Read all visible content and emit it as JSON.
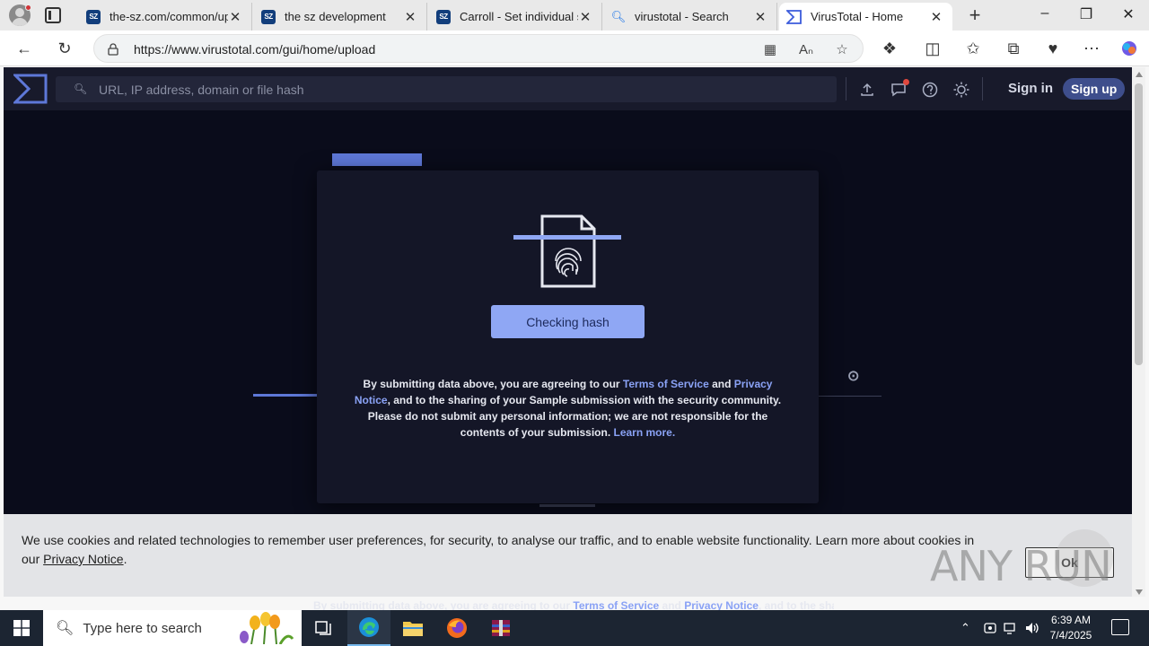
{
  "browser": {
    "tabs": [
      {
        "title": "the-sz.com/common/upl",
        "favicon": "sz-icon"
      },
      {
        "title": "the sz development",
        "favicon": "sz-icon"
      },
      {
        "title": "Carroll - Set individual sc",
        "favicon": "sz-icon"
      },
      {
        "title": "virustotal - Search",
        "favicon": "search-icon"
      },
      {
        "title": "VirusTotal - Home",
        "favicon": "virustotal-icon",
        "active": true
      }
    ],
    "url": "https://www.virustotal.com/gui/home/upload"
  },
  "vt": {
    "search_placeholder": "URL, IP address, domain or file hash",
    "sign_in": "Sign in",
    "sign_up": "Sign up"
  },
  "modal": {
    "status": "Checking hash",
    "legal": {
      "p1": "By submitting data above, you are agreeing to our ",
      "tos": "Terms of Service",
      "and": " and ",
      "privacy": "Privacy Notice",
      "p2": ", and to the ",
      "strong": "sharing of your Sample submission with the security community.",
      "p3": " Please do not submit any personal information; we are not responsible for the contents of your submission. ",
      "learn": "Learn more."
    }
  },
  "cookie": {
    "text": "We use cookies and related technologies to remember user preferences, for security, to analyse our traffic, and to enable website functionality. Learn more about cookies in our ",
    "link": "Privacy Notice",
    "end": ".",
    "ok": "Ok"
  },
  "page_peek": {
    "p1": "By submitting data above, you are agreeing to our ",
    "tos": "Terms of Service",
    "and": " and ",
    "privacy": "Privacy Notice",
    "p2": ", and to the ",
    "strong": "sharing of your"
  },
  "watermark": "ANY RUN",
  "taskbar": {
    "search_placeholder": "Type here to search",
    "time": "6:39 AM",
    "date": "7/4/2025"
  },
  "colors": {
    "vt_bg": "#0a0c1b",
    "vt_accent": "#8fa7f4",
    "vt_link": "#8aa2f5",
    "taskbar": "#1c2532"
  }
}
